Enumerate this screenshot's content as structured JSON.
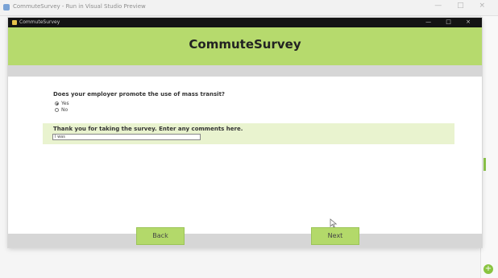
{
  "browser": {
    "title": "CommuteSurvey - Run in Visual Studio Preview",
    "controls": "— □ ×"
  },
  "window": {
    "title": "CommuteSurvey",
    "controls": "— □ ×"
  },
  "app": {
    "header_title": "CommuteSurvey"
  },
  "question": {
    "text": "Does your employer promote the use of mass transit?",
    "options": [
      {
        "label": "Yes",
        "selected": true
      },
      {
        "label": "No",
        "selected": false
      }
    ]
  },
  "comments": {
    "label": "Thank you for taking the survey. Enter any comments here.",
    "value": "I was"
  },
  "footer": {
    "back_label": "Back",
    "next_label": "Next"
  },
  "side": {
    "fab_label": "+"
  },
  "colors": {
    "accent_green": "#b6da6d",
    "light_green": "#e9f3cf",
    "button_green": "#b3d96a",
    "titlebar": "#141414",
    "gray_band": "#d6d6d6"
  },
  "icons": [
    "app-icon",
    "window-icon",
    "radio-checked",
    "radio-unchecked",
    "mouse-cursor-icon",
    "plus-icon"
  ]
}
